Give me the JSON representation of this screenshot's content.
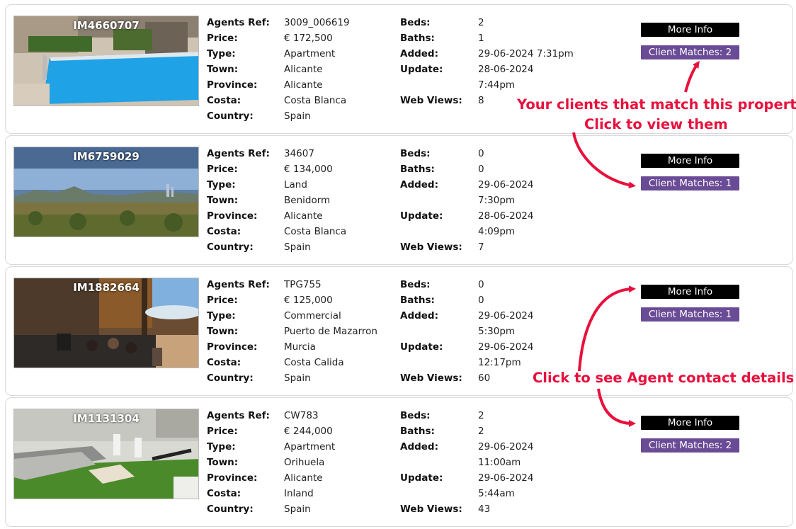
{
  "labels": {
    "agents_ref": "Agents Ref:",
    "price": "Price:",
    "type": "Type:",
    "town": "Town:",
    "province": "Province:",
    "costa": "Costa:",
    "country": "Country:",
    "beds": "Beds:",
    "baths": "Baths:",
    "added": "Added:",
    "update": "Update:",
    "web_views": "Web Views:"
  },
  "listings": [
    {
      "id": "IM4660707",
      "image": "swimming-pool-photo",
      "agents_ref": "3009_006619",
      "price": "€ 172,500",
      "type": "Apartment",
      "town": "Alicante",
      "province": "Alicante",
      "costa": "Costa Blanca",
      "country": "Spain",
      "beds": "2",
      "baths": "1",
      "added_1": "29-06-2024 7:31pm",
      "added_2": "",
      "update_1": "28-06-2024",
      "update_2": "7:44pm",
      "web_views": "8",
      "more_info": "More Info",
      "client_matches": "Client Matches: 2"
    },
    {
      "id": "IM6759029",
      "image": "land-with-mountains-photo",
      "agents_ref": "34607",
      "price": "€ 134,000",
      "type": "Land",
      "town": "Benidorm",
      "province": "Alicante",
      "costa": "Costa Blanca",
      "country": "Spain",
      "beds": "0",
      "baths": "0",
      "added_1": "29-06-2024",
      "added_2": "7:30pm",
      "update_1": "28-06-2024",
      "update_2": "4:09pm",
      "web_views": "7",
      "more_info": "More Info",
      "client_matches": "Client Matches: 1"
    },
    {
      "id": "IM1882664",
      "image": "restaurant-terrace-photo",
      "agents_ref": "TPG755",
      "price": "€ 125,000",
      "type": "Commercial",
      "town": "Puerto de Mazarron",
      "province": "Murcia",
      "costa": "Costa Calida",
      "country": "Spain",
      "beds": "0",
      "baths": "0",
      "added_1": "29-06-2024",
      "added_2": "5:30pm",
      "update_1": "29-06-2024",
      "update_2": "12:17pm",
      "web_views": "60",
      "more_info": "More Info",
      "client_matches": "Client Matches: 1"
    },
    {
      "id": "IM1131304",
      "image": "patio-furniture-photo",
      "agents_ref": "CW783",
      "price": "€ 244,000",
      "type": "Apartment",
      "town": "Orihuela",
      "province": "Alicante",
      "costa": "Inland",
      "country": "Spain",
      "beds": "2",
      "baths": "2",
      "added_1": "29-06-2024",
      "added_2": "11:00am",
      "update_1": "29-06-2024",
      "update_2": "5:44am",
      "web_views": "43",
      "more_info": "More Info",
      "client_matches": "Client Matches: 2"
    }
  ],
  "annotations": {
    "matches_line1": "Your clients that match this property",
    "matches_line2": "Click to view them",
    "agent_contact": "Click to see Agent contact details"
  },
  "colors": {
    "annotation": "#e8103c",
    "more_info_bg": "#000000",
    "client_matches_bg": "#6a4b95"
  }
}
